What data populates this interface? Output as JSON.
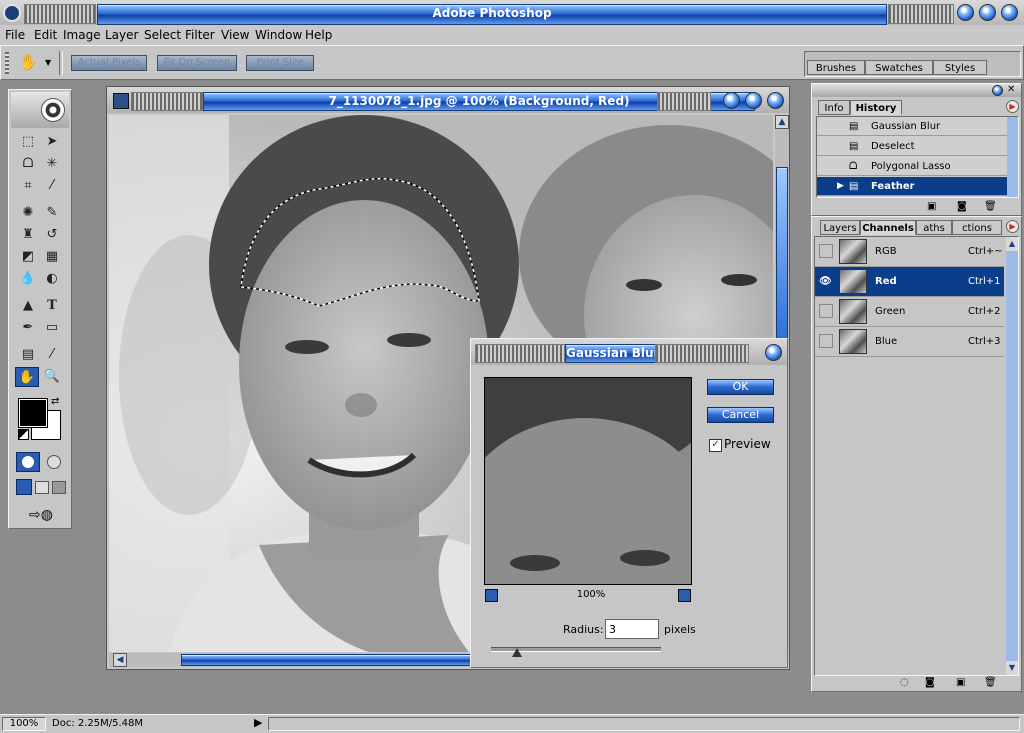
{
  "app": {
    "title": "Adobe Photoshop"
  },
  "menu": [
    "File",
    "Edit",
    "Image",
    "Layer",
    "Select",
    "Filter",
    "View",
    "Window",
    "Help"
  ],
  "options": {
    "buttons": [
      "Actual Pixels",
      "Fit On Screen",
      "Print Size"
    ]
  },
  "brushes_panel": {
    "tabs": [
      "Brushes",
      "Swatches",
      "Styles"
    ]
  },
  "document": {
    "title": "7_1130078_1.jpg @ 100% (Background, Red)"
  },
  "history_panel": {
    "tabs": [
      "Info",
      "History"
    ],
    "items": [
      "Gaussian Blur",
      "Deselect",
      "Polygonal Lasso",
      "Feather"
    ],
    "selected_index": 3
  },
  "channels_panel": {
    "tabs": [
      "Layers",
      "Channels",
      "Paths",
      "Actions"
    ],
    "tab_labels_visible": [
      "Layers",
      "Channels",
      "aths",
      "ctions"
    ],
    "items": [
      {
        "name": "RGB",
        "shortcut": "Ctrl+~"
      },
      {
        "name": "Red",
        "shortcut": "Ctrl+1"
      },
      {
        "name": "Green",
        "shortcut": "Ctrl+2"
      },
      {
        "name": "Blue",
        "shortcut": "Ctrl+3"
      }
    ],
    "selected_index": 1
  },
  "dialog": {
    "title": "Gaussian Blur",
    "title_visible": "Gaussian Blur",
    "ok": "OK",
    "cancel": "Cancel",
    "preview_label": "Preview",
    "preview_checked": true,
    "zoom": "100%",
    "radius_label": "Radius:",
    "radius_value": "3",
    "units": "pixels",
    "slider_fraction": 0.15
  },
  "status": {
    "zoom": "100%",
    "doc": "Doc: 2.25M/5.48M"
  },
  "colors": {
    "accent": "#0a3d8a",
    "chrome": "#c8c8c8",
    "background": "#8c8c8c"
  }
}
